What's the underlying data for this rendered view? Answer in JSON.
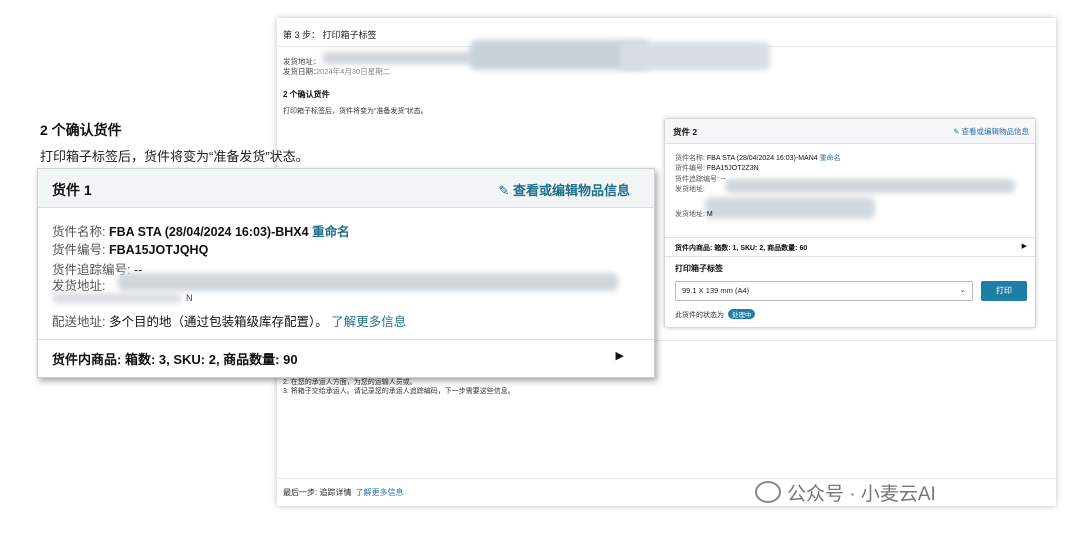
{
  "background_page": {
    "step_title": "第 3 步： 打印箱子标签",
    "ship_from_label": "发货地址：",
    "ship_date_label": "发货日期：",
    "ship_date_value": "2024年4月30日星期二",
    "confirm_heading": "2 个确认货件",
    "confirm_note": "打印箱子标签后，货件将变为“准备发货”状态。",
    "instruction_2": "2. 在您的承运人方面，为您的运输人员或。",
    "instruction_3": "3. 将箱子交给承运人。请记录您的承运人追踪编码，下一步需要这些信息。",
    "final_step": "最后一步: 追踪详情",
    "final_step_link": "了解更多信息"
  },
  "shipment2": {
    "title": "货件 2",
    "edit_link": "查看或编辑物品信息",
    "name_label": "货件名称:",
    "name_value": "FBA STA (28/04/2024 16:03)-MAN4",
    "rename": "重命名",
    "id_label": "货件编号:",
    "id_value": "FBA15JOT2Z3N",
    "tracking_label": "货件追踪编号:",
    "tracking_value": "--",
    "address_label": "发货地址:",
    "dest_label": "发货地址:",
    "dest_value": "M",
    "items_summary": "货件内商品: 箱数: 1, SKU: 2, 商品数量: 60",
    "print_label_heading": "打印箱子标签",
    "select_value": "99.1 X 139 mm (A4)",
    "print_button": "打印",
    "status_label": "此货件的状态为",
    "status_badge": "处理中"
  },
  "foreground": {
    "heading": "2 个确认货件",
    "subtext": "打印箱子标签后，货件将变为“准备发货”状态。"
  },
  "shipment1": {
    "title": "货件 1",
    "edit_link": "查看或编辑物品信息",
    "name_label": "货件名称:",
    "name_value": "FBA STA (28/04/2024 16:03)-BHX4",
    "rename": "重命名",
    "id_label": "货件编号:",
    "id_value": "FBA15JOTJQHQ",
    "tracking_label": "货件追踪编号:",
    "tracking_value": "--",
    "address_label": "发货地址:",
    "address_tail": "N",
    "dest_label": "配送地址:",
    "dest_value": "多个目的地（通过包装箱级库存配置）。",
    "dest_link": "了解更多信息",
    "items_summary": "货件内商品: 箱数: 3, SKU: 2, 商品数量: 90"
  },
  "watermark": "公众号 · 小麦云AI",
  "colors": {
    "link": "#1f6f8b",
    "primary_button": "#1c7fa6"
  }
}
